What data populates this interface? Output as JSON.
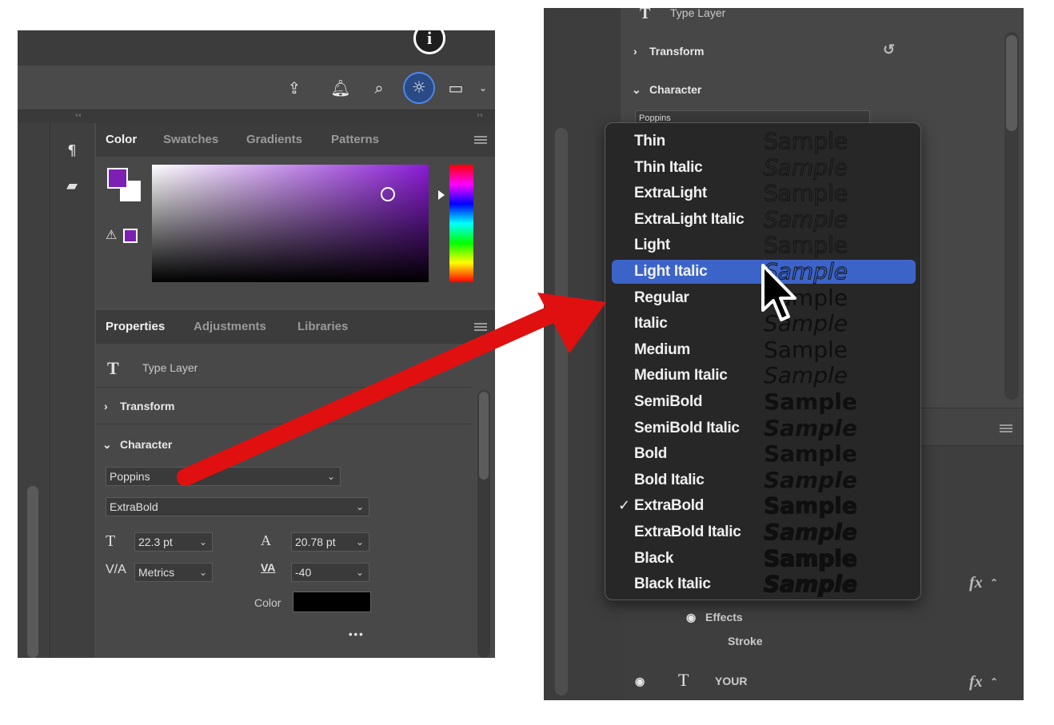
{
  "left": {
    "info_label": "i",
    "toolbar_icons": [
      "share-icon",
      "bell-icon",
      "search-icon",
      "lightbulb-icon",
      "panel-icon",
      "chevron-down-icon"
    ],
    "collapse_left": "‹‹",
    "collapse_right": "››",
    "color_panel": {
      "tabs": [
        "Color",
        "Swatches",
        "Gradients",
        "Patterns"
      ],
      "active_tab": "Color",
      "foreground": "#7d1fb3",
      "background": "#ffffff"
    },
    "properties_panel": {
      "tabs": [
        "Properties",
        "Adjustments",
        "Libraries"
      ],
      "active_tab": "Properties",
      "layer_type": "Type Layer",
      "transform_label": "Transform",
      "character_label": "Character",
      "font_family": "Poppins",
      "font_style": "ExtraBold",
      "font_size": "22.3 pt",
      "leading": "20.78 pt",
      "kerning": "Metrics",
      "tracking": "-40",
      "color_label": "Color",
      "color_value": "#000000",
      "more": "•••"
    }
  },
  "right": {
    "layer_type": "Type Layer",
    "transform_label": "Transform",
    "character_label": "Character",
    "font_family_partial": "Poppins",
    "effects_label": "Effects",
    "stroke_label": "Stroke",
    "layer_name": "YOUR",
    "fx_label": "fx"
  },
  "font_styles": [
    {
      "name": "Thin",
      "sample": "Sample"
    },
    {
      "name": "Thin Italic",
      "sample": "Sample"
    },
    {
      "name": "ExtraLight",
      "sample": "Sample"
    },
    {
      "name": "ExtraLight Italic",
      "sample": "Sample"
    },
    {
      "name": "Light",
      "sample": "Sample"
    },
    {
      "name": "Light Italic",
      "sample": "Sample"
    },
    {
      "name": "Regular",
      "sample": "Sample"
    },
    {
      "name": "Italic",
      "sample": "Sample"
    },
    {
      "name": "Medium",
      "sample": "Sample"
    },
    {
      "name": "Medium Italic",
      "sample": "Sample"
    },
    {
      "name": "SemiBold",
      "sample": "Sample"
    },
    {
      "name": "SemiBold Italic",
      "sample": "Sample"
    },
    {
      "name": "Bold",
      "sample": "Sample"
    },
    {
      "name": "Bold Italic",
      "sample": "Sample"
    },
    {
      "name": "ExtraBold",
      "sample": "Sample"
    },
    {
      "name": "ExtraBold Italic",
      "sample": "Sample"
    },
    {
      "name": "Black",
      "sample": "Sample"
    },
    {
      "name": "Black Italic",
      "sample": "Sample"
    }
  ],
  "highlighted_style": "Light Italic",
  "checked_style": "ExtraBold",
  "check_mark": "✓",
  "annotation_color": "#e01010"
}
